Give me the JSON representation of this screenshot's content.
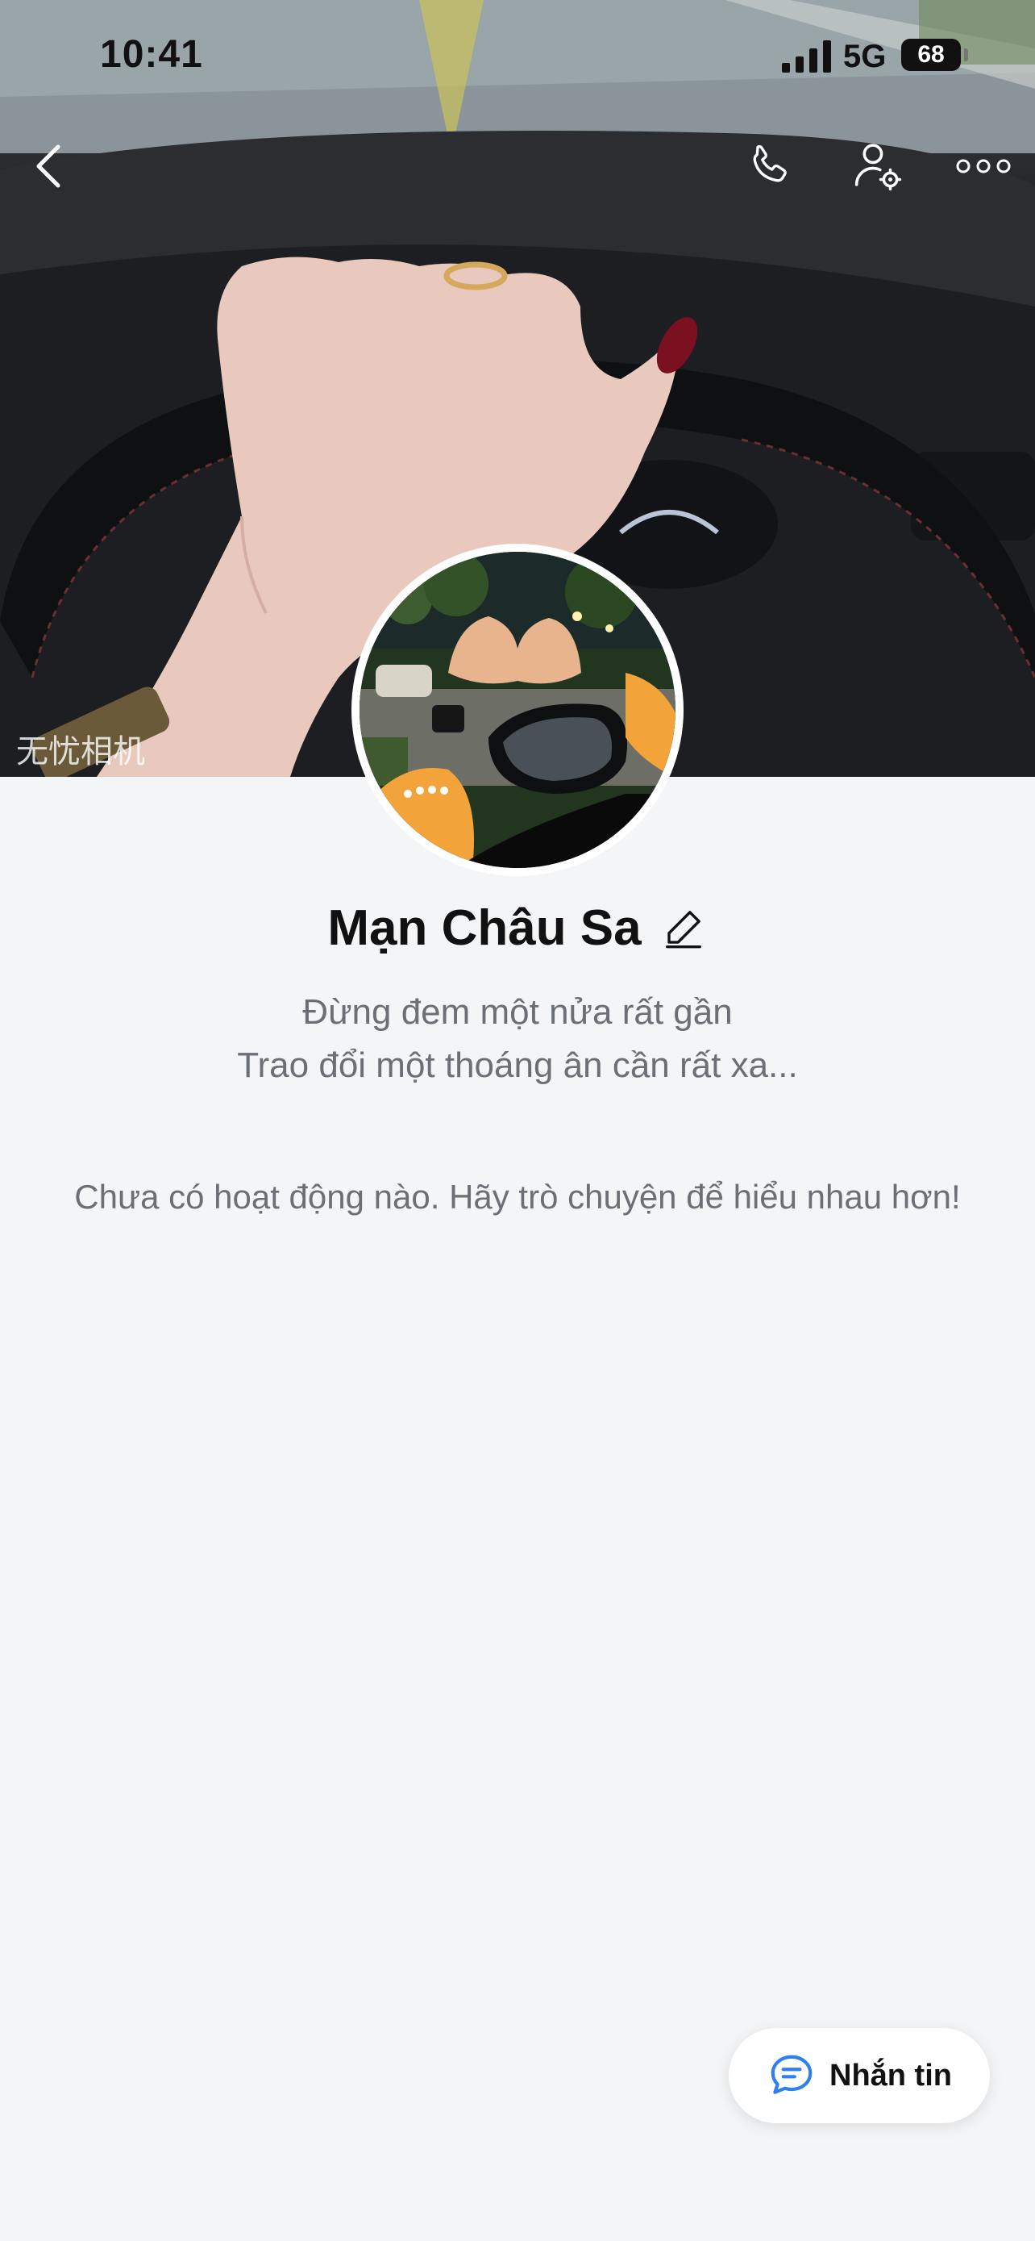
{
  "status_bar": {
    "time": "10:41",
    "network": "5G",
    "battery": "68"
  },
  "header": {
    "back_icon": "chevron-left-icon",
    "call_icon": "phone-icon",
    "settings_icon": "user-settings-icon",
    "more_icon": "more-dots-icon"
  },
  "cover": {
    "watermark": "无忧相机"
  },
  "profile": {
    "name": "Mạn Châu Sa",
    "edit_icon": "pencil-icon",
    "bio_line1": "Đừng đem một nửa rất gần",
    "bio_line2": "Trao đổi một thoáng ân cần rất xa..."
  },
  "feed": {
    "empty_message": "Chưa có hoạt động nào. Hãy trò chuyện để hiểu nhau hơn!"
  },
  "actions": {
    "message_label": "Nhắn tin",
    "message_icon": "chat-bubble-icon"
  },
  "colors": {
    "accent": "#2f7ff0",
    "background": "#f4f5f7",
    "text_primary": "#111111",
    "text_secondary": "#6b6f76"
  }
}
